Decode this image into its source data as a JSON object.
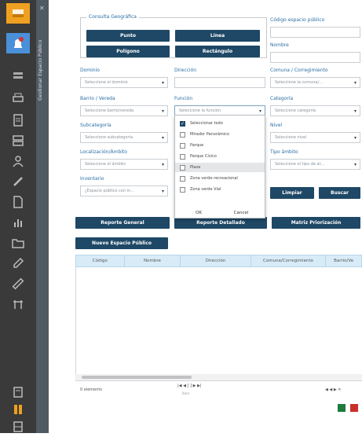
{
  "sidebar": {
    "panel_label": "Gestionar Espacio Público",
    "icons": [
      "app-icon",
      "alert-icon",
      "layers-icon",
      "printer-icon",
      "report-icon",
      "server-icon",
      "user-icon",
      "pen-icon",
      "document-icon",
      "chart-icon",
      "folder-icon",
      "edit-icon",
      "ruler-icon",
      "table-icon",
      "info-icon",
      "pause-icon",
      "grid-icon"
    ]
  },
  "geo_query": {
    "legend": "Consulta Geográfica",
    "buttons": [
      "Punto",
      "Línea",
      "Polígono",
      "Rectángulo"
    ]
  },
  "form": {
    "codigo_label": "Código espacio público",
    "nombre_label": "Nombre",
    "dominio_label": "Dominio",
    "dominio_placeholder": "Seleccione el dominio",
    "direccion_label": "Dirección",
    "comuna_label": "Comuna / Corregimiento",
    "comuna_placeholder": "Seleccione la comuna/...",
    "barrio_label": "Barrio / Vereda",
    "barrio_placeholder": "Seleccione barrio/vereda",
    "funcion_label": "Función",
    "funcion_placeholder": "Seleccione la función",
    "categoria_label": "Categoría",
    "categoria_placeholder": "Seleccione categoría",
    "subcategoria_label": "Subcategoría",
    "subcategoria_placeholder": "Seleccione subcategoría",
    "nivel_label": "Nivel",
    "nivel_placeholder": "Seleccione nivel",
    "localizacion_label": "Localización/Ámbito",
    "localizacion_placeholder": "Seleccione el ámbito",
    "tipo_label": "Tipo ámbito",
    "tipo_placeholder": "Seleccione el tipo de ár...",
    "inventario_label": "Inventario",
    "inventario_placeholder": "¿Espacio público con in...",
    "limpiar": "Limpiar",
    "buscar": "Buscar"
  },
  "dropdown": {
    "items": [
      {
        "label": "Seleccionar todo",
        "checked": true
      },
      {
        "label": "Mirador Panorámico",
        "checked": false
      },
      {
        "label": "Parque",
        "checked": false
      },
      {
        "label": "Parque Cívico",
        "checked": false
      },
      {
        "label": "Plaza",
        "checked": false
      },
      {
        "label": "Zona verde recreacional",
        "checked": false
      },
      {
        "label": "Zona verde Vial",
        "checked": false
      }
    ],
    "ok": "OK",
    "cancel": "Cancel"
  },
  "actions": {
    "reporte_general": "Reporte General",
    "reporte_detallado": "Reporte Detallado",
    "matriz": "Matriz Priorización",
    "nuevo": "Nuevo Espacio Público"
  },
  "grid": {
    "columns": [
      "Código",
      "Nombre",
      "Dirección",
      "Comuna/Corregimiento",
      "Barrio/Ve"
    ]
  },
  "pager": {
    "count": "0 elements",
    "controls": "|◀  ◀  [  ]  ▶  ▶|",
    "sub": "Item",
    "nav": "◀  ◀  ▶  ✕"
  },
  "colors": {
    "primary": "#1e4866",
    "accent": "#f0a020",
    "label": "#2a6ea5"
  }
}
